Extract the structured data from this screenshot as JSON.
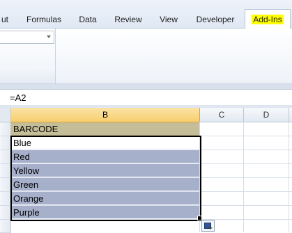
{
  "ribbon": {
    "tabs": [
      {
        "label": "ut"
      },
      {
        "label": "Formulas"
      },
      {
        "label": "Data"
      },
      {
        "label": "Review"
      },
      {
        "label": "View"
      },
      {
        "label": "Developer"
      },
      {
        "label": "Add-Ins",
        "active": true
      }
    ],
    "highlight_color": "#ffff00"
  },
  "formula_bar": {
    "formula": "=A2"
  },
  "columns": [
    "B",
    "C",
    "D"
  ],
  "sheet": {
    "header_cell": "BARCODE",
    "values": [
      "Blue",
      "Red",
      "Yellow",
      "Green",
      "Orange",
      "Purple"
    ],
    "header_fill": "#c4bd97",
    "data_fill": "#a7b0cb"
  }
}
